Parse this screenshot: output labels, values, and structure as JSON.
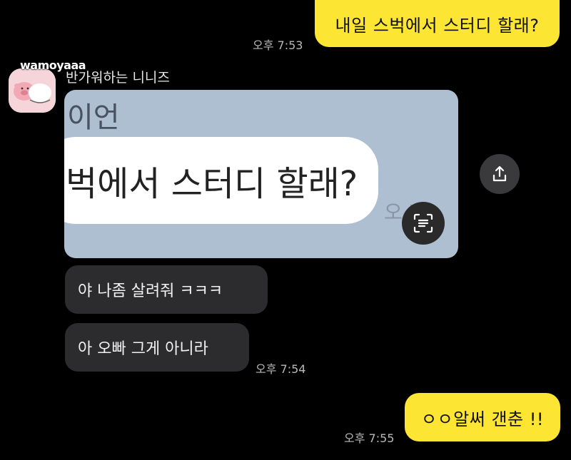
{
  "messages": {
    "m1": {
      "text": "내일 스벅에서 스터디 할래?",
      "time": "오후 7:53"
    },
    "sender": {
      "name": "wamoyaaa",
      "nickname": "반가워하는 니니즈"
    },
    "image": {
      "title_fragment": "이언",
      "bubble_text": "벅에서 스터디 할래?",
      "time_fragment": "오 7:"
    },
    "m2": {
      "text": "야 나좀 살려줘 ㅋㅋㅋ"
    },
    "m3": {
      "text": "아 오빠 그게 아니라",
      "time": "오후 7:54"
    },
    "m4": {
      "text": "ㅇㅇ알써 갠춘 !!",
      "time": "오후 7:55"
    }
  },
  "icons": {
    "share": "share-icon",
    "scan": "text-scan-icon"
  },
  "colors": {
    "outgoing_bubble": "#fde533",
    "incoming_bubble": "#2c2c2e",
    "background": "#000000",
    "image_bg": "#aebfd2"
  }
}
